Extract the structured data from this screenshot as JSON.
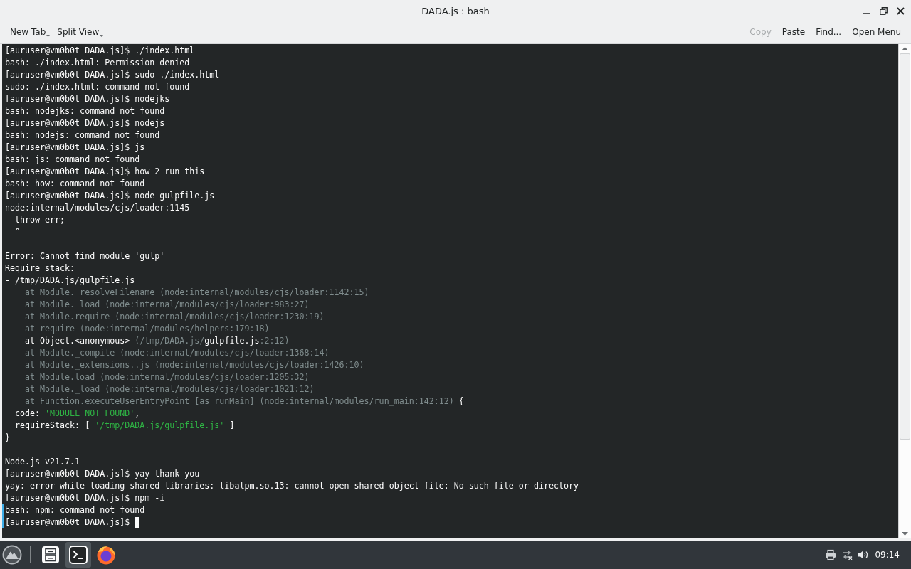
{
  "window": {
    "title": "DADA.js : bash"
  },
  "toolbar": {
    "left_buttons": [
      {
        "label": "New Tab",
        "dropdown": true
      },
      {
        "label": "Split View",
        "dropdown": true
      }
    ],
    "right_buttons": [
      {
        "label": "Copy",
        "disabled": true
      },
      {
        "label": "Paste",
        "disabled": false
      },
      {
        "label": "Find...",
        "disabled": false
      },
      {
        "label": "Open Menu",
        "disabled": false
      }
    ]
  },
  "terminal": {
    "cursor_visible": true,
    "blocks": [
      {
        "lines": [
          {
            "text": "[auruser@vm0b0t DADA.js]$ ./index.html"
          },
          {
            "text": "bash: ./index.html: Permission denied"
          },
          {
            "text": "[auruser@vm0b0t DADA.js]$ sudo ./index.html"
          },
          {
            "text": "sudo: ./index.html: command not found"
          },
          {
            "text": "[auruser@vm0b0t DADA.js]$ nodejks"
          },
          {
            "text": "bash: nodejks: command not found"
          },
          {
            "text": "[auruser@vm0b0t DADA.js]$ nodejs"
          },
          {
            "text": "bash: nodejs: command not found"
          },
          {
            "text": "[auruser@vm0b0t DADA.js]$ js"
          },
          {
            "text": "bash: js: command not found"
          },
          {
            "text": "[auruser@vm0b0t DADA.js]$ how 2 run this"
          },
          {
            "text": "bash: how: command not found"
          },
          {
            "text": "[auruser@vm0b0t DADA.js]$ node gulpfile.js"
          },
          {
            "text": "node:internal/modules/cjs/loader:1145"
          },
          {
            "text": "  throw err;"
          },
          {
            "text": "  ^"
          }
        ]
      },
      {
        "lines": [
          {
            "text": "Error: Cannot find module 'gulp'"
          },
          {
            "text": "Require stack:"
          },
          {
            "text": "- /tmp/DADA.js/gulpfile.js"
          },
          {
            "text": "    at Module._resolveFilename (node:internal/modules/cjs/loader:1142:15)",
            "color": "#7f8c8d"
          },
          {
            "text": "    at Module._load (node:internal/modules/cjs/loader:983:27)",
            "color": "#7f8c8d"
          },
          {
            "text": "    at Module.require (node:internal/modules/cjs/loader:1230:19)",
            "color": "#7f8c8d"
          },
          {
            "text": "    at require (node:internal/modules/helpers:179:18)",
            "color": "#7f8c8d"
          },
          {
            "segments": [
              {
                "text": "    at Object.<anonymous> "
              },
              {
                "text": "(/tmp/DADA.js/",
                "color": "#7f8c8d"
              },
              {
                "text": "gulpfile.js"
              },
              {
                "text": ":2:12)",
                "color": "#7f8c8d"
              }
            ]
          },
          {
            "text": "    at Module._compile (node:internal/modules/cjs/loader:1368:14)",
            "color": "#7f8c8d"
          },
          {
            "text": "    at Module._extensions..js (node:internal/modules/cjs/loader:1426:10)",
            "color": "#7f8c8d"
          },
          {
            "text": "    at Module.load (node:internal/modules/cjs/loader:1205:32)",
            "color": "#7f8c8d"
          },
          {
            "text": "    at Module._load (node:internal/modules/cjs/loader:1021:12)",
            "color": "#7f8c8d"
          },
          {
            "segments": [
              {
                "text": "    at Function.executeUserEntryPoint [as runMain] (node:internal/modules/run_main:142:12)",
                "color": "#7f8c8d"
              },
              {
                "text": " {"
              }
            ]
          },
          {
            "segments": [
              {
                "text": "  code: "
              },
              {
                "text": "'MODULE_NOT_FOUND'",
                "color": "#2fb344"
              },
              {
                "text": ","
              }
            ]
          },
          {
            "segments": [
              {
                "text": "  requireStack: [ "
              },
              {
                "text": "'/tmp/DADA.js/gulpfile.js'",
                "color": "#2fb344"
              },
              {
                "text": " ]"
              }
            ]
          },
          {
            "text": "}"
          }
        ]
      },
      {
        "lines": [
          {
            "text": "Node.js v21.7.1"
          },
          {
            "text": "[auruser@vm0b0t DADA.js]$ yay thank you"
          },
          {
            "text": "yay: error while loading shared libraries: libalpm.so.13: cannot open shared object file: No such file or directory"
          },
          {
            "text": "[auruser@vm0b0t DADA.js]$ npm -i"
          },
          {
            "text": "bash: npm: command not found"
          },
          {
            "text": "[auruser@vm0b0t DADA.js]$"
          }
        ]
      }
    ]
  },
  "taskbar": {
    "tasks": [
      {
        "kind": "files",
        "selected": false
      },
      {
        "kind": "terminal",
        "selected": true
      },
      {
        "kind": "browser",
        "selected": false
      }
    ],
    "clock": "09:14"
  }
}
